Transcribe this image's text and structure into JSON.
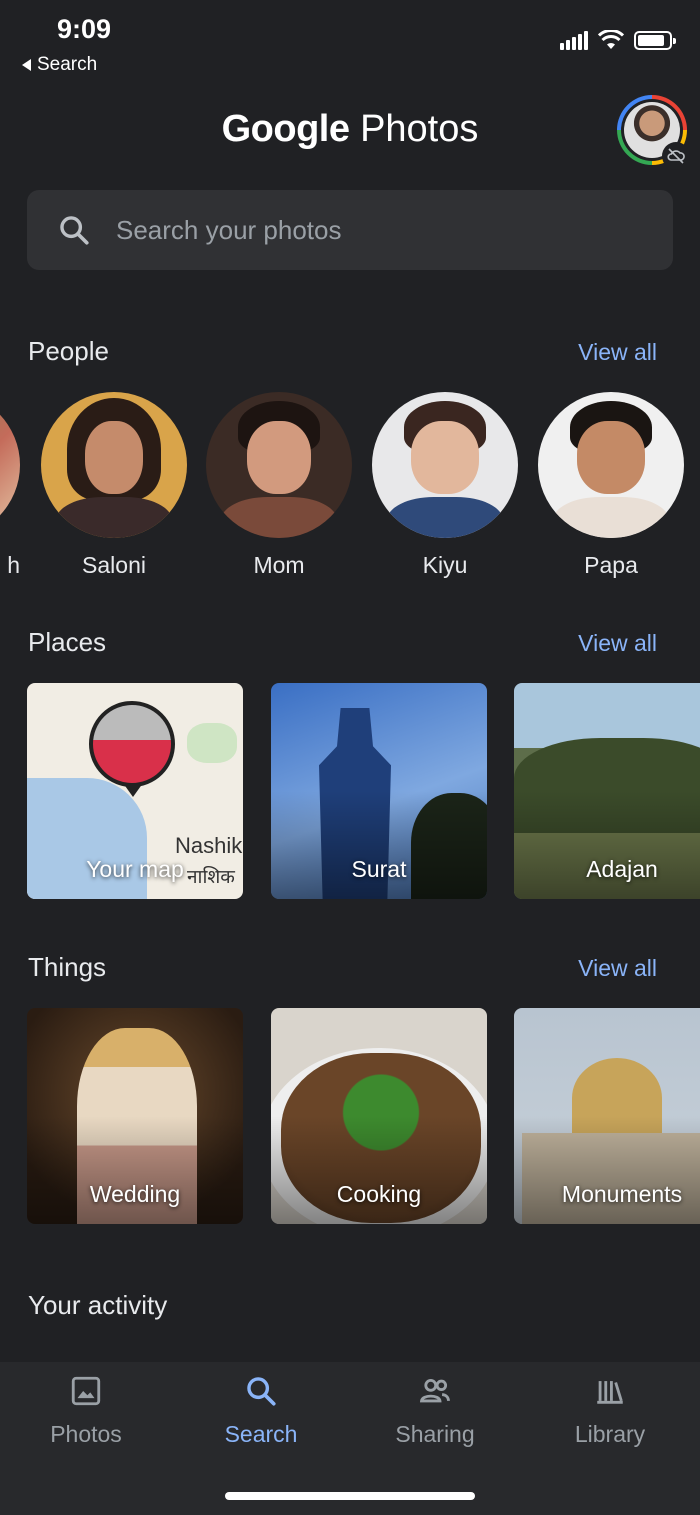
{
  "status_bar": {
    "time": "9:09",
    "back_label": "Search",
    "battery_level": 0.85
  },
  "header": {
    "title_google": "Google",
    "title_photos": "Photos",
    "avatar_icon": "account-avatar",
    "backup_icon": "cloud-off-icon"
  },
  "search": {
    "placeholder": "Search your photos",
    "icon": "search-icon"
  },
  "people": {
    "title": "People",
    "view_all": "View all",
    "items": [
      {
        "name": "Saloni"
      },
      {
        "name": "Mom"
      },
      {
        "name": "Kiyu"
      },
      {
        "name": "Papa"
      }
    ],
    "partial_label": "h"
  },
  "places": {
    "title": "Places",
    "view_all": "View all",
    "items": [
      {
        "label": "Your map",
        "map_text_1": "Nashik",
        "map_text_2": "नाशिक"
      },
      {
        "label": "Surat"
      },
      {
        "label": "Adajan"
      }
    ]
  },
  "things": {
    "title": "Things",
    "view_all": "View all",
    "items": [
      {
        "label": "Wedding"
      },
      {
        "label": "Cooking"
      },
      {
        "label": "Monuments"
      }
    ]
  },
  "activity": {
    "title": "Your activity"
  },
  "bottom_nav": {
    "items": [
      {
        "label": "Photos",
        "icon": "photo-icon"
      },
      {
        "label": "Search",
        "icon": "search-icon",
        "active": true
      },
      {
        "label": "Sharing",
        "icon": "people-icon"
      },
      {
        "label": "Library",
        "icon": "library-icon"
      }
    ]
  },
  "colors": {
    "background": "#202124",
    "accent": "#8ab4f8",
    "surface": "#303134"
  }
}
